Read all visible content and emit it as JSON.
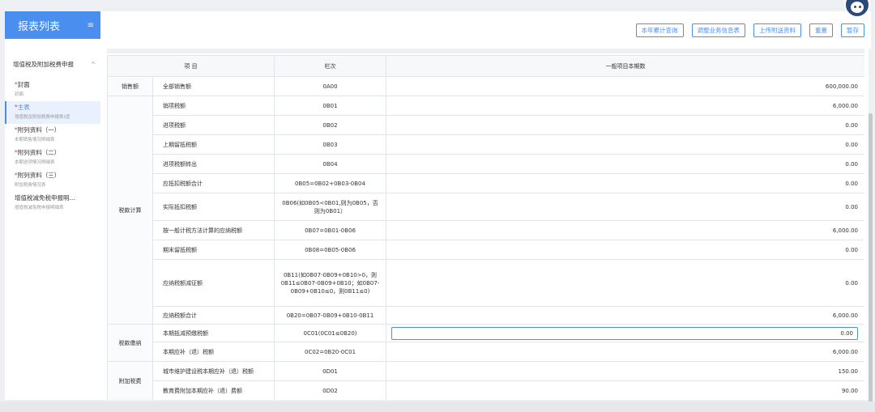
{
  "sidebar": {
    "title": "报表列表",
    "menu_icon": "≡",
    "group": {
      "label": "增值税及附加税费申报",
      "chevron": "^"
    },
    "items": [
      {
        "star": "*",
        "title": "封面",
        "subtitle": "封面",
        "active": false
      },
      {
        "star": "*",
        "title": "主表",
        "subtitle": "增值税及附加税费申报表(适",
        "active": true
      },
      {
        "star": "*",
        "title": "附列资料（一）",
        "subtitle": "本期销售情况明细表",
        "active": false
      },
      {
        "star": "*",
        "title": "附列资料（二）",
        "subtitle": "本期进项情况明细表",
        "active": false
      },
      {
        "star": "*",
        "title": "附列资料（三）",
        "subtitle": "附加税费情况表",
        "active": false
      },
      {
        "star": "",
        "title": "增值税减免税申报明...",
        "subtitle": "增值税减免税申报明细表",
        "active": false
      }
    ]
  },
  "toolbar": {
    "buttons": [
      "本年累计查询",
      "调整业务信息表",
      "上传附送资料",
      "重置",
      "暂存"
    ]
  },
  "table": {
    "headers": [
      "项  目",
      "栏次",
      "一般项目本期数"
    ],
    "rows": [
      {
        "cat": "销售额",
        "item": "全部销售额",
        "code": "0A00",
        "value": "600,000.00"
      },
      {
        "cat": "税款计算",
        "item": "销项税额",
        "code": "0B01",
        "value": "6,000.00"
      },
      {
        "item": "进项税额",
        "code": "0B02",
        "value": "0.00"
      },
      {
        "item": "上期留抵税额",
        "code": "0B03",
        "value": "0.00"
      },
      {
        "item": "进项税额转出",
        "code": "0B04",
        "value": "0.00"
      },
      {
        "item": "应抵扣税额合计",
        "code": "0B05=0B02+0B03-0B04",
        "value": "0.00"
      },
      {
        "item": "实际抵扣税额",
        "code": "0B06(如0B05<0B01,则为0B05，否则为0B01）",
        "value": "0.00"
      },
      {
        "item": "按一般计税方法计算的应纳税额",
        "code": "0B07=0B01-0B06",
        "value": "6,000.00"
      },
      {
        "item": "期末留抵税额",
        "code": "0B08=0B05-0B06",
        "value": "0.00"
      },
      {
        "item": "应纳税额减征额",
        "code": "0B11(如0B07-0B09+0B10>0，则0B11≤0B07-0B09+0B10；如0B07-0B09+0B10≤0，则0B11≤0)",
        "value": "0.00"
      },
      {
        "item": "应纳税额合计",
        "code": "0B20=0B07-0B09+0B10-0B11",
        "value": "6,000.00"
      },
      {
        "cat": "税款缴纳",
        "item": "本期抵减预缴税额",
        "code": "0C01(0C01≤0B20)",
        "value": "0.00",
        "editable": true
      },
      {
        "item": "本期应补（退）税额",
        "code": "0C02=0B20-0C01",
        "value": "6,000.00"
      },
      {
        "cat": "附加税费",
        "item": "城市维护建设税本期应补（退）税额",
        "code": "0D01",
        "value": "150.00"
      },
      {
        "item": "教育费附加本期应补（退）费额",
        "code": "0D02",
        "value": "90.00"
      }
    ]
  },
  "colors": {
    "accent": "#4a8ef0",
    "required": "#e64040"
  }
}
